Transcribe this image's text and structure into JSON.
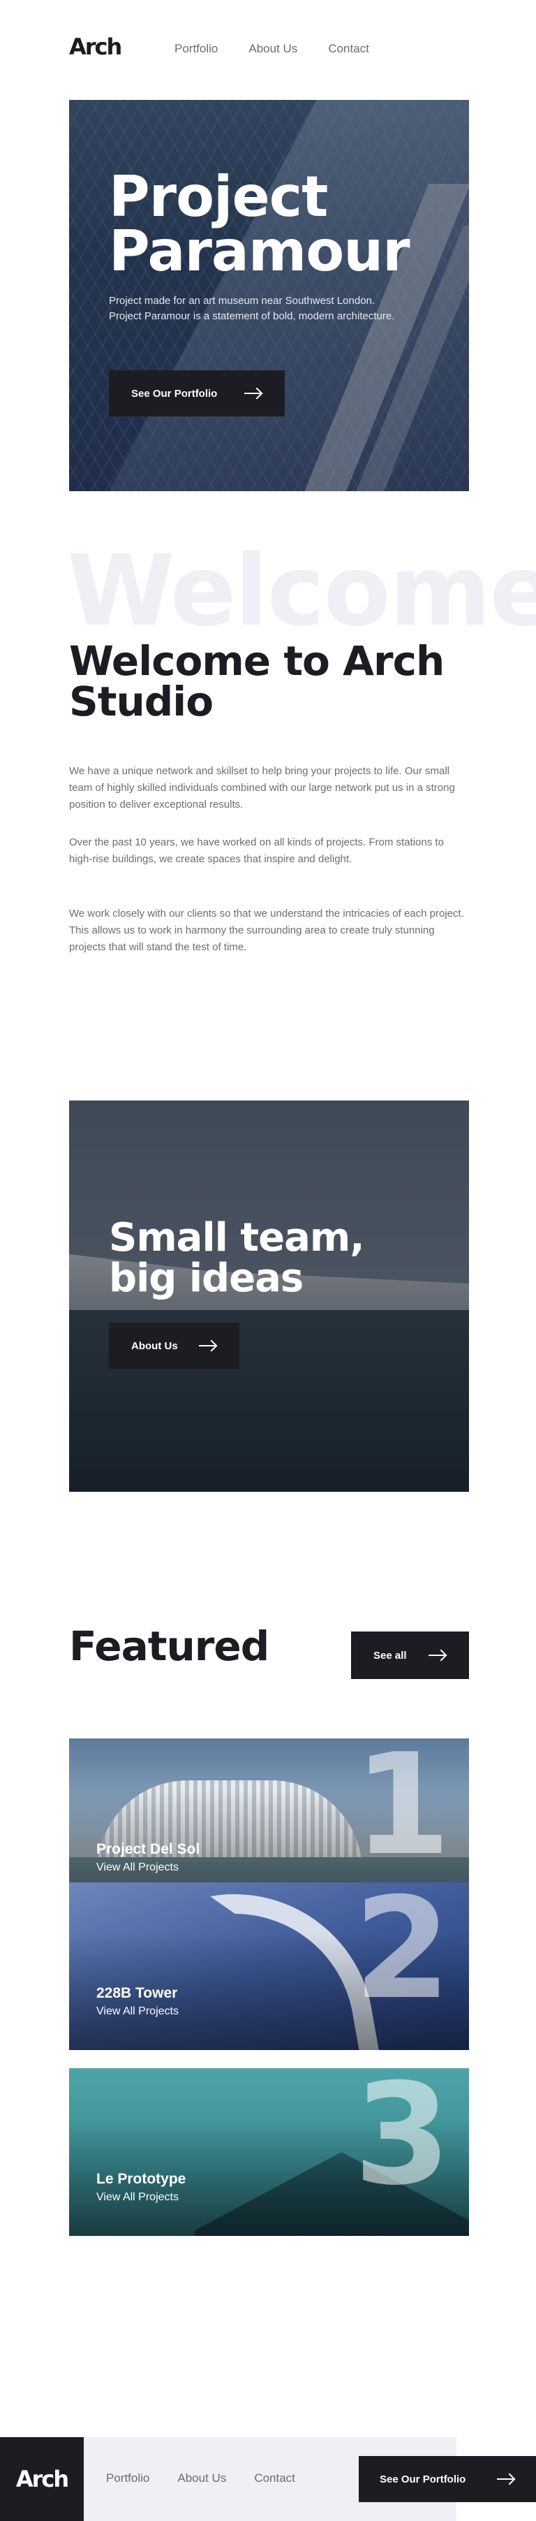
{
  "header": {
    "logo": "Arch",
    "nav": [
      "Portfolio",
      "About Us",
      "Contact"
    ]
  },
  "hero": {
    "title": "Project\nParamour",
    "text": "Project made for an art museum near Southwest London. Project Paramour is a statement of bold, modern architecture.",
    "button": "See Our Portfolio"
  },
  "welcome": {
    "ghost": "Welcome",
    "title": "Welcome to Arch Studio",
    "paragraphs": [
      "We have a unique network and skillset to help bring your projects to life. Our small team of highly skilled individuals combined with our large network put us in a strong position to deliver exceptional results.",
      "Over the past 10 years, we have worked on all kinds of projects. From stations to high-rise buildings, we create spaces that inspire and delight.",
      "We work closely with our clients so that we understand the intricacies of each project. This allows us to work in harmony the surrounding area to create truly stunning projects that will stand the test of time."
    ]
  },
  "team": {
    "title": "Small team,\nbig ideas",
    "button": "About Us"
  },
  "featured": {
    "title": "Featured",
    "see_all": "See all",
    "cards": [
      {
        "num": "1",
        "name": "Project Del Sol",
        "link": "View All Projects"
      },
      {
        "num": "2",
        "name": "228B Tower",
        "link": "View All Projects"
      },
      {
        "num": "3",
        "name": "Le Prototype",
        "link": "View All Projects"
      }
    ]
  },
  "footer": {
    "logo": "Arch",
    "nav": [
      "Portfolio",
      "About Us",
      "Contact"
    ],
    "button": "See Our Portfolio"
  },
  "colors": {
    "dark": "#1b1d23",
    "gray_text": "#6c6d72",
    "light_bg": "#eef0f5"
  }
}
